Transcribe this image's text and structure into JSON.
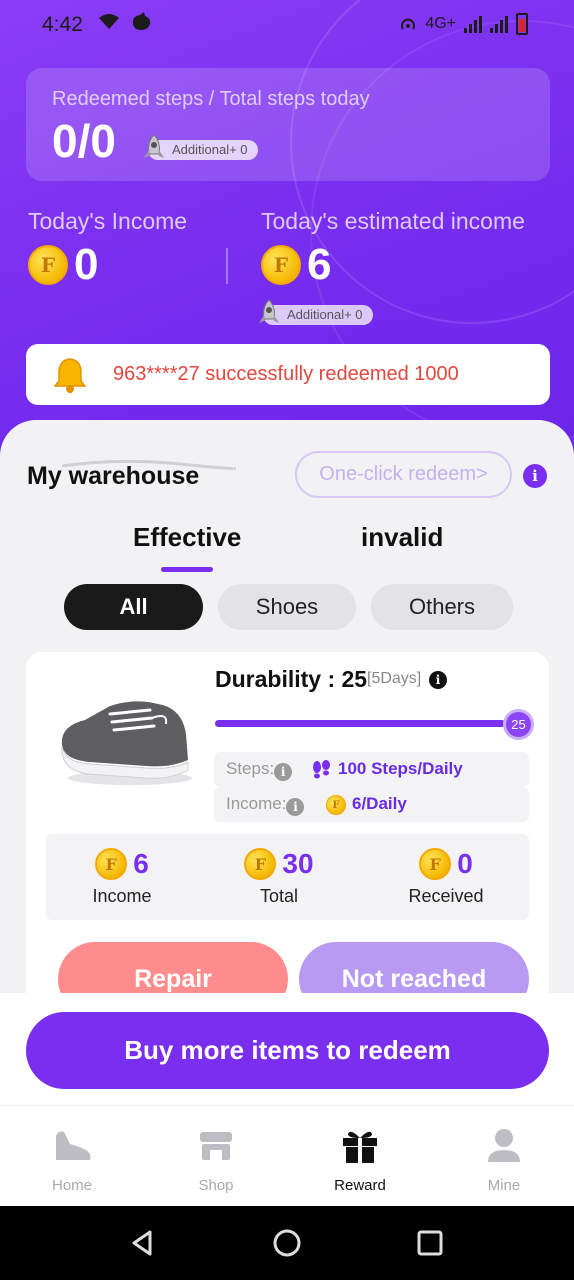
{
  "status_bar": {
    "time": "4:42",
    "network": "4G+"
  },
  "steps_card": {
    "label": "Redeemed steps / Total steps today",
    "value": "0/0",
    "additional": "Additional+ 0"
  },
  "income": {
    "today_label": "Today's Income",
    "today_value": "0",
    "estimated_label": "Today's estimated income",
    "estimated_value": "6",
    "additional": "Additional+ 0"
  },
  "notice": {
    "text": "963****27 successfully redeemed 1000"
  },
  "warehouse": {
    "title": "My warehouse",
    "oneclick_label": "One-click redeem>",
    "info_glyph": "i"
  },
  "tabs": [
    {
      "label": "Effective",
      "active": true
    },
    {
      "label": "invalid",
      "active": false
    }
  ],
  "filters": [
    {
      "label": "All",
      "active": true
    },
    {
      "label": "Shoes",
      "active": false
    },
    {
      "label": "Others",
      "active": false
    }
  ],
  "item": {
    "durability_label": "Durability : 25",
    "durability_days": "[5Days]",
    "durability_value": 25,
    "durability_fraction": 0.96,
    "knob_label": "25",
    "steps_label": "Steps:",
    "steps_value": "100 Steps/Daily",
    "income_label": "Income:",
    "income_value": "6/Daily",
    "stats": [
      {
        "value": "6",
        "label": "Income"
      },
      {
        "value": "30",
        "label": "Total"
      },
      {
        "value": "0",
        "label": "Received"
      }
    ],
    "repair_label": "Repair",
    "not_reached_label": "Not reached"
  },
  "buy_button": "Buy more items to redeem",
  "nav": [
    {
      "label": "Home",
      "icon": "shoe-icon",
      "active": false
    },
    {
      "label": "Shop",
      "icon": "store-icon",
      "active": false
    },
    {
      "label": "Reward",
      "icon": "gift-icon",
      "active": true
    },
    {
      "label": "Mine",
      "icon": "user-icon",
      "active": false
    }
  ],
  "colors": {
    "primary": "#7a2ff0",
    "repair": "#ff8c8c",
    "not_reached": "#b99af3",
    "notice_text": "#e2463e",
    "coin": "#f5b800"
  }
}
